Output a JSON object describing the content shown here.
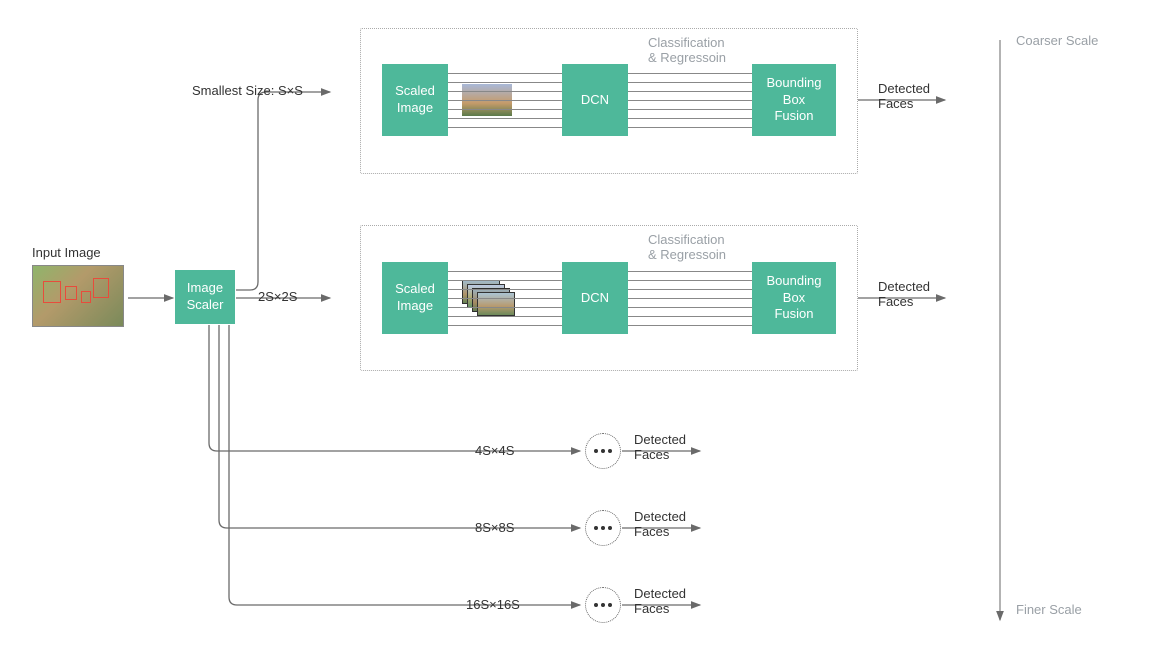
{
  "input": {
    "label": "Input Image"
  },
  "scaler": {
    "label": "Image\nScaler"
  },
  "scales": [
    {
      "size_label": "Smallest Size: S×S",
      "output": "Detected\nFaces"
    },
    {
      "size_label": "2S×2S",
      "output": "Detected\nFaces"
    },
    {
      "size_label": "4S×4S",
      "output": "Detected\nFaces"
    },
    {
      "size_label": "8S×8S",
      "output": "Detected\nFaces"
    },
    {
      "size_label": "16S×16S",
      "output": "Detected\nFaces"
    }
  ],
  "pipeline": {
    "scaled_image": "Scaled\nImage",
    "dcn": "DCN",
    "bbox_fusion": "Bounding\nBox\nFusion",
    "class_reg": "Classification\n& Regressoin"
  },
  "scale_bar": {
    "top": "Coarser Scale",
    "bottom": "Finer Scale"
  }
}
